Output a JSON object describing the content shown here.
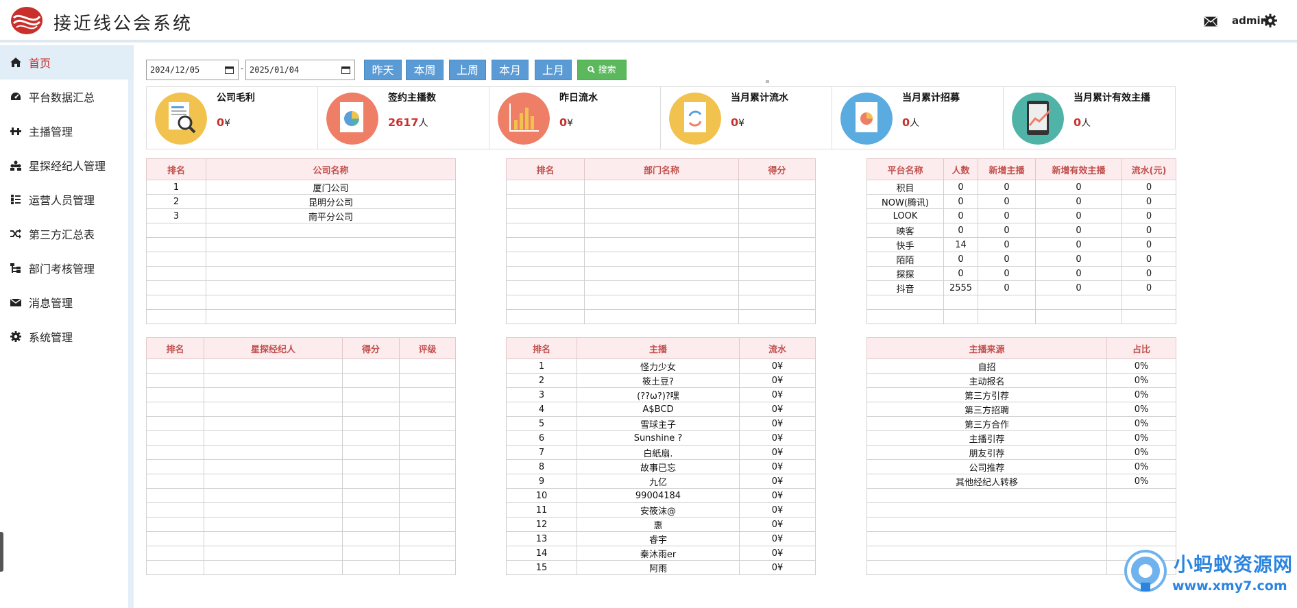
{
  "header": {
    "title": "接近线公会系统",
    "user": "admin"
  },
  "sidebar": {
    "items": [
      {
        "label": "首页",
        "icon": "home-icon"
      },
      {
        "label": "平台数据汇总",
        "icon": "dashboard-icon"
      },
      {
        "label": "主播管理",
        "icon": "streamer-icon"
      },
      {
        "label": "星探经纪人管理",
        "icon": "users-icon"
      },
      {
        "label": "运营人员管理",
        "icon": "list-icon"
      },
      {
        "label": "第三方汇总表",
        "icon": "shuffle-icon"
      },
      {
        "label": "部门考核管理",
        "icon": "sitemap-icon"
      },
      {
        "label": "消息管理",
        "icon": "envelope-icon"
      },
      {
        "label": "系统管理",
        "icon": "gear-icon"
      }
    ]
  },
  "toolbar": {
    "start_date": "2024/12/05",
    "end_date": "2025/01/04",
    "separator": "-",
    "buttons": [
      "昨天",
      "本周",
      "上周",
      "本月",
      "上月"
    ],
    "search_label": "搜索"
  },
  "stats": [
    {
      "label": "公司毛利",
      "value": "0",
      "unit": "¥",
      "color": "#f2c24f"
    },
    {
      "label": "签约主播数",
      "value": "2617",
      "unit": "人",
      "color": "#ee7f66"
    },
    {
      "label": "昨日流水",
      "value": "0",
      "unit": "¥",
      "color": "#ee7f66"
    },
    {
      "label": "当月累计流水",
      "value": "0",
      "unit": "¥",
      "color": "#f2c24f"
    },
    {
      "label": "当月累计招募",
      "value": "0",
      "unit": "人",
      "color": "#5aace0"
    },
    {
      "label": "当月累计有效主播",
      "value": "0",
      "unit": "人",
      "color": "#4fb3a7"
    }
  ],
  "company_table": {
    "headers": [
      "排名",
      "公司名称"
    ],
    "rows": [
      [
        "1",
        "厦门公司"
      ],
      [
        "2",
        "昆明分公司"
      ],
      [
        "3",
        "南平分公司"
      ]
    ]
  },
  "department_table": {
    "headers": [
      "排名",
      "部门名称",
      "得分"
    ],
    "rows": []
  },
  "platform_table": {
    "headers": [
      "平台名称",
      "人数",
      "新增主播",
      "新增有效主播",
      "流水(元)"
    ],
    "rows": [
      [
        "积目",
        "0",
        "0",
        "0",
        "0"
      ],
      [
        "NOW(腾讯)",
        "0",
        "0",
        "0",
        "0"
      ],
      [
        "LOOK",
        "0",
        "0",
        "0",
        "0"
      ],
      [
        "映客",
        "0",
        "0",
        "0",
        "0"
      ],
      [
        "快手",
        "14",
        "0",
        "0",
        "0"
      ],
      [
        "陌陌",
        "0",
        "0",
        "0",
        "0"
      ],
      [
        "探探",
        "0",
        "0",
        "0",
        "0"
      ],
      [
        "抖音",
        "2555",
        "0",
        "0",
        "0"
      ]
    ]
  },
  "agent_table": {
    "headers": [
      "排名",
      "星探经纪人",
      "得分",
      "评级"
    ],
    "rows": []
  },
  "streamer_table": {
    "headers": [
      "排名",
      "主播",
      "流水"
    ],
    "rows": [
      [
        "1",
        "怪力少女",
        "0¥"
      ],
      [
        "2",
        "筱土豆?",
        "0¥"
      ],
      [
        "3",
        "(??ω?)?嘿",
        "0¥"
      ],
      [
        "4",
        "A$BCD",
        "0¥"
      ],
      [
        "5",
        "雪球主子",
        "0¥"
      ],
      [
        "6",
        "Sunshine ?",
        "0¥"
      ],
      [
        "7",
        "白紙扇.",
        "0¥"
      ],
      [
        "8",
        "故事已忘",
        "0¥"
      ],
      [
        "9",
        "九亿",
        "0¥"
      ],
      [
        "10",
        "99004184",
        "0¥"
      ],
      [
        "11",
        "安筱沫@",
        "0¥"
      ],
      [
        "12",
        "惠",
        "0¥"
      ],
      [
        "13",
        "睿宇",
        "0¥"
      ],
      [
        "14",
        "秦沐雨er",
        "0¥"
      ],
      [
        "15",
        "阿雨",
        "0¥"
      ]
    ]
  },
  "source_table": {
    "headers": [
      "主播来源",
      "占比"
    ],
    "rows": [
      [
        "自招",
        "0%"
      ],
      [
        "主动报名",
        "0%"
      ],
      [
        "第三方引荐",
        "0%"
      ],
      [
        "第三方招聘",
        "0%"
      ],
      [
        "第三方合作",
        "0%"
      ],
      [
        "主播引荐",
        "0%"
      ],
      [
        "朋友引荐",
        "0%"
      ],
      [
        "公司推荐",
        "0%"
      ],
      [
        "其他经纪人转移",
        "0%"
      ]
    ]
  },
  "watermark": {
    "title": "小蚂蚁资源网",
    "url": "www.xmy7.com"
  }
}
